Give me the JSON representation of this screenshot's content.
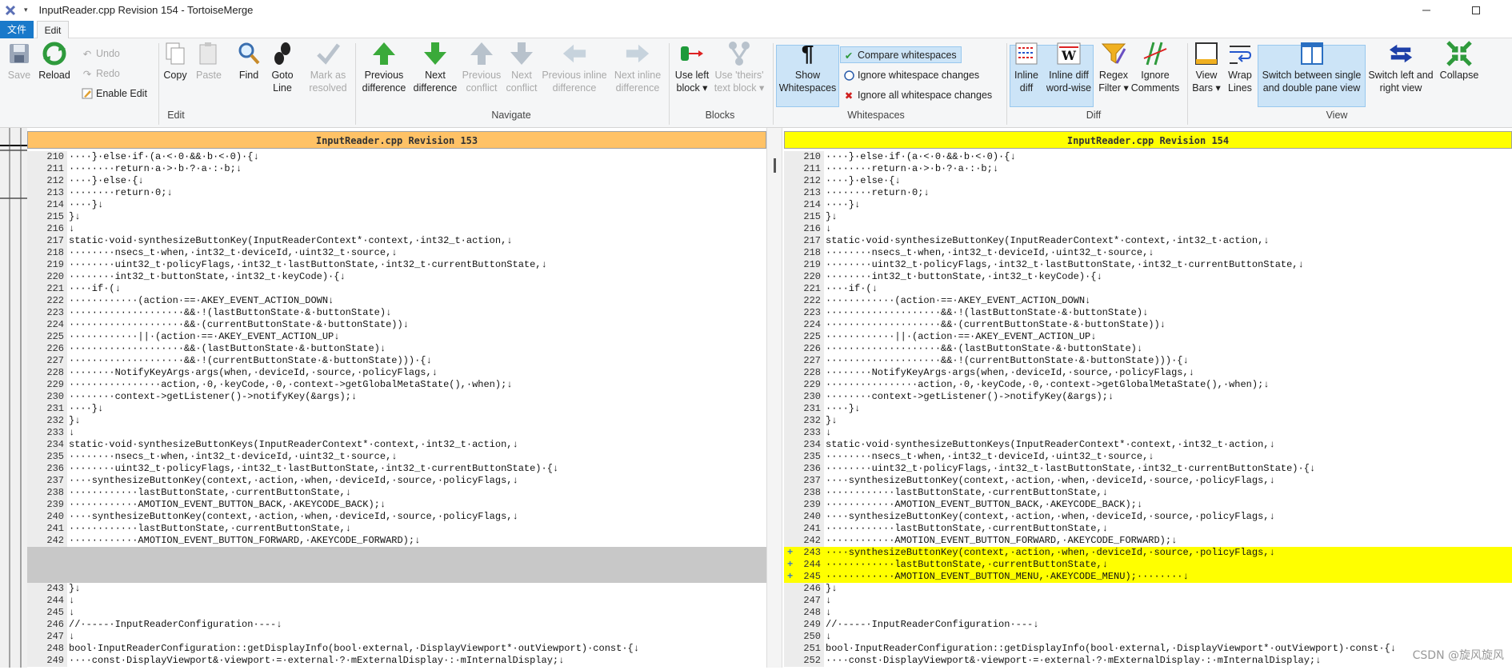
{
  "window": {
    "title": "InputReader.cpp Revision 154 - TortoiseMerge",
    "quick_access": "▾"
  },
  "menu": {
    "file": "文件",
    "edit": "Edit"
  },
  "ribbon": {
    "save": "Save",
    "reload": "Reload",
    "undo": "Undo",
    "redo": "Redo",
    "enable_edit": "Enable Edit",
    "copy": "Copy",
    "paste": "Paste",
    "find": "Find",
    "goto_line": [
      "Goto",
      "Line"
    ],
    "mark_resolved": [
      "Mark as",
      "resolved"
    ],
    "prev_diff": [
      "Previous",
      "difference"
    ],
    "next_diff": [
      "Next",
      "difference"
    ],
    "prev_conflict": [
      "Previous",
      "conflict"
    ],
    "next_conflict": [
      "Next",
      "conflict"
    ],
    "prev_inline": [
      "Previous inline",
      "difference"
    ],
    "next_inline": [
      "Next inline",
      "difference"
    ],
    "use_left_block": [
      "Use left",
      "block ▾"
    ],
    "use_theirs": [
      "Use 'theirs'",
      "text block ▾"
    ],
    "show_whitespaces": [
      "Show",
      "Whitespaces"
    ],
    "compare_whitespaces": "Compare whitespaces",
    "ignore_ws_changes": "Ignore whitespace changes",
    "ignore_all_ws": "Ignore all whitespace changes",
    "inline_diff": [
      "Inline",
      "diff"
    ],
    "inline_diff_word": [
      "Inline diff",
      "word-wise"
    ],
    "regex_filter": [
      "Regex",
      "Filter ▾"
    ],
    "ignore_comments": [
      "Ignore",
      "Comments"
    ],
    "view_bars": [
      "View",
      "Bars ▾"
    ],
    "wrap_lines": [
      "Wrap",
      "Lines"
    ],
    "switch_pane": [
      "Switch between single",
      "and double pane view"
    ],
    "switch_lr": [
      "Switch left and",
      "right view"
    ],
    "collapse": "Collapse",
    "groups": {
      "edit": "Edit",
      "navigate": "Navigate",
      "blocks": "Blocks",
      "whitespaces": "Whitespaces",
      "diff": "Diff",
      "view": "View"
    }
  },
  "left_pane": {
    "header": "InputReader.cpp Revision 153",
    "lines": [
      {
        "n": "210",
        "t": "····}·else·if·(a·<·0·&&·b·<·0)·{↓"
      },
      {
        "n": "211",
        "t": "········return·a·>·b·?·a·:·b;↓"
      },
      {
        "n": "212",
        "t": "····}·else·{↓"
      },
      {
        "n": "213",
        "t": "········return·0;↓"
      },
      {
        "n": "214",
        "t": "····}↓"
      },
      {
        "n": "215",
        "t": "}↓"
      },
      {
        "n": "216",
        "t": "↓"
      },
      {
        "n": "217",
        "t": "static·void·synthesizeButtonKey(InputReaderContext*·context,·int32_t·action,↓"
      },
      {
        "n": "218",
        "t": "········nsecs_t·when,·int32_t·deviceId,·uint32_t·source,↓"
      },
      {
        "n": "219",
        "t": "········uint32_t·policyFlags,·int32_t·lastButtonState,·int32_t·currentButtonState,↓"
      },
      {
        "n": "220",
        "t": "········int32_t·buttonState,·int32_t·keyCode)·{↓"
      },
      {
        "n": "221",
        "t": "····if·(↓"
      },
      {
        "n": "222",
        "t": "············(action·==·AKEY_EVENT_ACTION_DOWN↓"
      },
      {
        "n": "223",
        "t": "····················&&·!(lastButtonState·&·buttonState)↓"
      },
      {
        "n": "224",
        "t": "····················&&·(currentButtonState·&·buttonState))↓"
      },
      {
        "n": "225",
        "t": "············||·(action·==·AKEY_EVENT_ACTION_UP↓"
      },
      {
        "n": "226",
        "t": "····················&&·(lastButtonState·&·buttonState)↓"
      },
      {
        "n": "227",
        "t": "····················&&·!(currentButtonState·&·buttonState)))·{↓"
      },
      {
        "n": "228",
        "t": "········NotifyKeyArgs·args(when,·deviceId,·source,·policyFlags,↓"
      },
      {
        "n": "229",
        "t": "················action,·0,·keyCode,·0,·context->getGlobalMetaState(),·when);↓"
      },
      {
        "n": "230",
        "t": "········context->getListener()->notifyKey(&args);↓"
      },
      {
        "n": "231",
        "t": "····}↓"
      },
      {
        "n": "232",
        "t": "}↓"
      },
      {
        "n": "233",
        "t": "↓"
      },
      {
        "n": "234",
        "t": "static·void·synthesizeButtonKeys(InputReaderContext*·context,·int32_t·action,↓"
      },
      {
        "n": "235",
        "t": "········nsecs_t·when,·int32_t·deviceId,·uint32_t·source,↓"
      },
      {
        "n": "236",
        "t": "········uint32_t·policyFlags,·int32_t·lastButtonState,·int32_t·currentButtonState)·{↓"
      },
      {
        "n": "237",
        "t": "····synthesizeButtonKey(context,·action,·when,·deviceId,·source,·policyFlags,↓"
      },
      {
        "n": "238",
        "t": "············lastButtonState,·currentButtonState,↓"
      },
      {
        "n": "239",
        "t": "············AMOTION_EVENT_BUTTON_BACK,·AKEYCODE_BACK);↓"
      },
      {
        "n": "240",
        "t": "····synthesizeButtonKey(context,·action,·when,·deviceId,·source,·policyFlags,↓"
      },
      {
        "n": "241",
        "t": "············lastButtonState,·currentButtonState,↓"
      },
      {
        "n": "242",
        "t": "············AMOTION_EVENT_BUTTON_FORWARD,·AKEYCODE_FORWARD);↓"
      },
      {
        "n": "",
        "t": "",
        "filler": true
      },
      {
        "n": "",
        "t": "",
        "filler": true
      },
      {
        "n": "",
        "t": "",
        "filler": true
      },
      {
        "n": "243",
        "t": "}↓"
      },
      {
        "n": "244",
        "t": "↓"
      },
      {
        "n": "245",
        "t": "↓"
      },
      {
        "n": "246",
        "t": "//·----·InputReaderConfiguration·---↓"
      },
      {
        "n": "247",
        "t": "↓"
      },
      {
        "n": "248",
        "t": "bool·InputReaderConfiguration::getDisplayInfo(bool·external,·DisplayViewport*·outViewport)·const·{↓"
      },
      {
        "n": "249",
        "t": "····const·DisplayViewport&·viewport·=·external·?·mExternalDisplay·:·mInternalDisplay;↓"
      }
    ]
  },
  "right_pane": {
    "header": "InputReader.cpp Revision 154",
    "lines": [
      {
        "n": "210",
        "t": "····}·else·if·(a·<·0·&&·b·<·0)·{↓"
      },
      {
        "n": "211",
        "t": "········return·a·>·b·?·a·:·b;↓"
      },
      {
        "n": "212",
        "t": "····}·else·{↓"
      },
      {
        "n": "213",
        "t": "········return·0;↓"
      },
      {
        "n": "214",
        "t": "····}↓"
      },
      {
        "n": "215",
        "t": "}↓"
      },
      {
        "n": "216",
        "t": "↓"
      },
      {
        "n": "217",
        "t": "static·void·synthesizeButtonKey(InputReaderContext*·context,·int32_t·action,↓"
      },
      {
        "n": "218",
        "t": "········nsecs_t·when,·int32_t·deviceId,·uint32_t·source,↓"
      },
      {
        "n": "219",
        "t": "········uint32_t·policyFlags,·int32_t·lastButtonState,·int32_t·currentButtonState,↓"
      },
      {
        "n": "220",
        "t": "········int32_t·buttonState,·int32_t·keyCode)·{↓"
      },
      {
        "n": "221",
        "t": "····if·(↓"
      },
      {
        "n": "222",
        "t": "············(action·==·AKEY_EVENT_ACTION_DOWN↓"
      },
      {
        "n": "223",
        "t": "····················&&·!(lastButtonState·&·buttonState)↓"
      },
      {
        "n": "224",
        "t": "····················&&·(currentButtonState·&·buttonState))↓"
      },
      {
        "n": "225",
        "t": "············||·(action·==·AKEY_EVENT_ACTION_UP↓"
      },
      {
        "n": "226",
        "t": "····················&&·(lastButtonState·&·buttonState)↓"
      },
      {
        "n": "227",
        "t": "····················&&·!(currentButtonState·&·buttonState)))·{↓"
      },
      {
        "n": "228",
        "t": "········NotifyKeyArgs·args(when,·deviceId,·source,·policyFlags,↓"
      },
      {
        "n": "229",
        "t": "················action,·0,·keyCode,·0,·context->getGlobalMetaState(),·when);↓"
      },
      {
        "n": "230",
        "t": "········context->getListener()->notifyKey(&args);↓"
      },
      {
        "n": "231",
        "t": "····}↓"
      },
      {
        "n": "232",
        "t": "}↓"
      },
      {
        "n": "233",
        "t": "↓"
      },
      {
        "n": "234",
        "t": "static·void·synthesizeButtonKeys(InputReaderContext*·context,·int32_t·action,↓"
      },
      {
        "n": "235",
        "t": "········nsecs_t·when,·int32_t·deviceId,·uint32_t·source,↓"
      },
      {
        "n": "236",
        "t": "········uint32_t·policyFlags,·int32_t·lastButtonState,·int32_t·currentButtonState)·{↓"
      },
      {
        "n": "237",
        "t": "····synthesizeButtonKey(context,·action,·when,·deviceId,·source,·policyFlags,↓"
      },
      {
        "n": "238",
        "t": "············lastButtonState,·currentButtonState,↓"
      },
      {
        "n": "239",
        "t": "············AMOTION_EVENT_BUTTON_BACK,·AKEYCODE_BACK);↓"
      },
      {
        "n": "240",
        "t": "····synthesizeButtonKey(context,·action,·when,·deviceId,·source,·policyFlags,↓"
      },
      {
        "n": "241",
        "t": "············lastButtonState,·currentButtonState,↓"
      },
      {
        "n": "242",
        "t": "············AMOTION_EVENT_BUTTON_FORWARD,·AKEYCODE_FORWARD);↓"
      },
      {
        "n": "243",
        "t": "····synthesizeButtonKey(context,·action,·when,·deviceId,·source,·policyFlags,↓",
        "added": true
      },
      {
        "n": "244",
        "t": "············lastButtonState,·currentButtonState,↓",
        "added": true
      },
      {
        "n": "245",
        "t": "············AMOTION_EVENT_BUTTON_MENU,·AKEYCODE_MENU);········↓",
        "added": true
      },
      {
        "n": "246",
        "t": "}↓"
      },
      {
        "n": "247",
        "t": "↓"
      },
      {
        "n": "248",
        "t": "↓"
      },
      {
        "n": "249",
        "t": "//·----·InputReaderConfiguration·---↓"
      },
      {
        "n": "250",
        "t": "↓"
      },
      {
        "n": "251",
        "t": "bool·InputReaderConfiguration::getDisplayInfo(bool·external,·DisplayViewport*·outViewport)·const·{↓"
      },
      {
        "n": "252",
        "t": "····const·DisplayViewport&·viewport·=·external·?·mExternalDisplay·:·mInternalDisplay;↓"
      }
    ]
  },
  "added_marker": "+",
  "watermark": "CSDN @旋风旋风",
  "colors": {
    "left_header": "#ffc266",
    "right_header": "#ffff00",
    "added_line": "#ffff00",
    "filler": "#c8c8c8",
    "accent": "#1979ca"
  }
}
